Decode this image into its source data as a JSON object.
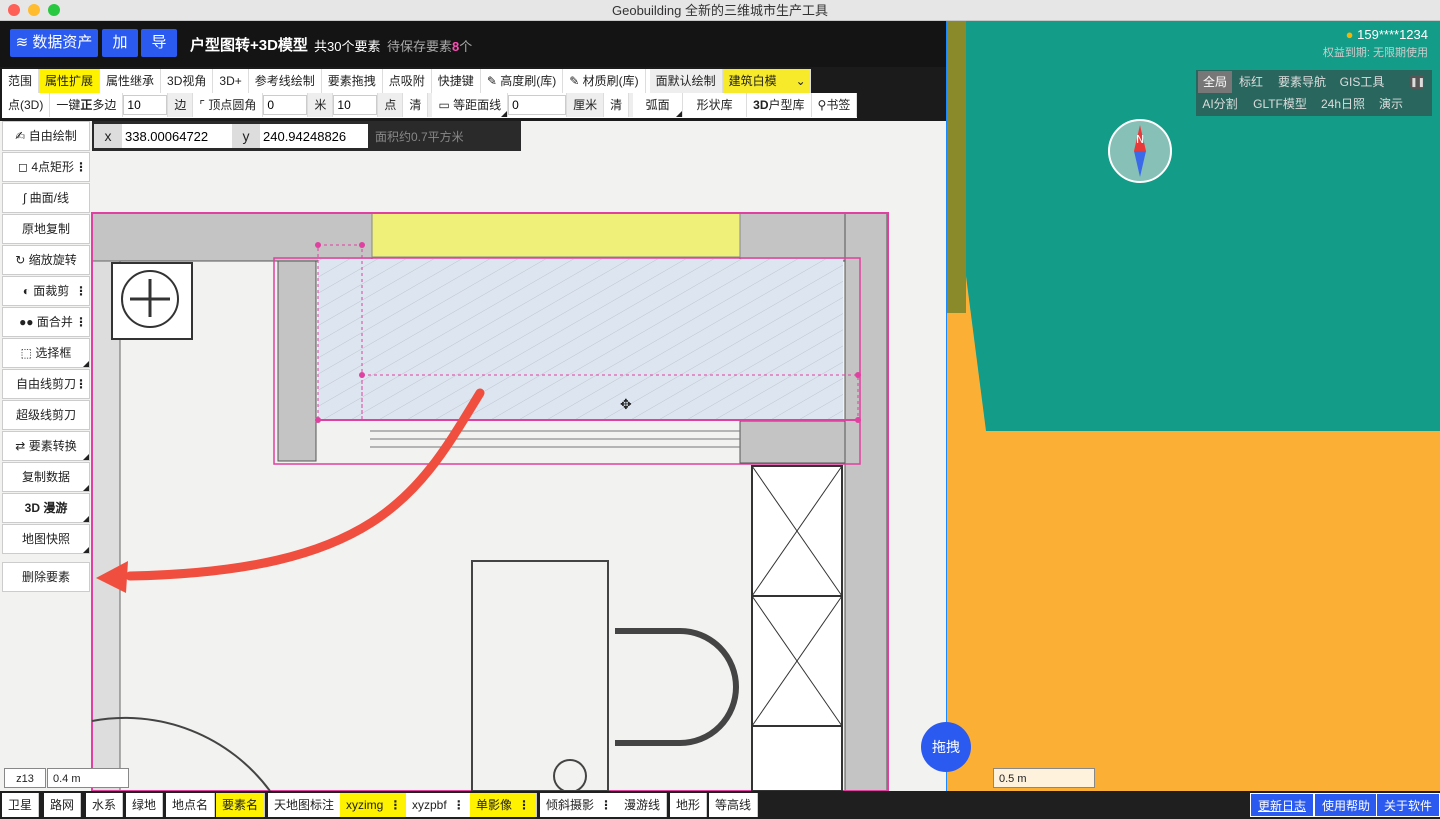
{
  "window": {
    "title": "Geobuilding 全新的三维城市生产工具"
  },
  "header": {
    "data_assets": "数据资产",
    "add": "加",
    "export": "导",
    "title": "户型图转+3D模型",
    "count": "共30个要素",
    "pending_prefix": "待保存要素",
    "pending_count": "8",
    "pending_suffix": "个",
    "user": "159****1234",
    "rights": "权益到期: 无限期使用"
  },
  "toolbar1": {
    "items": [
      "范围",
      "属性扩展",
      "属性继承",
      "3D视角",
      "3D+",
      "参考线绘制",
      "要素拖拽",
      "点吸附",
      "快捷键",
      "高度刷(库)",
      "材质刷(库)",
      "面默认绘制",
      "建筑白模"
    ]
  },
  "toolbar2": {
    "point3d": "点(3D)",
    "polygon_prefix": "一键",
    "polygon_bold": "正",
    "polygon_suffix": "多边",
    "sides_value": "10",
    "sides_unit": "边",
    "round": "顶点圆角",
    "round_value": "0",
    "round_unit": "米",
    "points_value": "10",
    "points_unit": "点",
    "clear1": "清",
    "offset": "等距面线",
    "offset_value": "0",
    "offset_unit": "厘米",
    "clear2": "清",
    "arc": "弧面",
    "shape_lib": "形状库",
    "house_lib_bold": "3D",
    "house_lib": "户型库",
    "bookmark": "书签"
  },
  "right_tabs": [
    "全局",
    "标红",
    "要素导航",
    "GIS工具",
    "AI分割",
    "GLTF模型",
    "24h日照",
    "演示"
  ],
  "left_tools": [
    "自由绘制",
    "4点矩形",
    "曲面/线",
    "原地复制",
    "缩放旋转",
    "面裁剪",
    "面合并",
    "选择框",
    "自由线剪刀",
    "超级线剪刀",
    "要素转换",
    "复制数据",
    "3D 漫游",
    "地图快照",
    "删除要素"
  ],
  "coord": {
    "x_label": "x",
    "x_value": "338.00064722",
    "y_label": "y",
    "y_value": "240.94248826",
    "area": "面积约0.7平方米"
  },
  "map": {
    "zoom": "z13",
    "scale_left": "0.4 m",
    "scale_right": "0.5 m",
    "drag": "拖拽",
    "compass": "N"
  },
  "bottom": {
    "items": [
      "卫星",
      "路网",
      "水系",
      "绿地",
      "地点名",
      "要素名",
      "天地图标注",
      "xyzimg",
      "xyzpbf",
      "单影像",
      "倾斜摄影",
      "漫游线",
      "地形",
      "等高线"
    ],
    "right": [
      "更新日志",
      "使用帮助",
      "关于软件"
    ]
  },
  "colors": {
    "accent": "#2b5af0",
    "highlight": "#fff200",
    "selection": "#e040a0",
    "arrow": "#f04e3e",
    "map3d_top": "#139c88",
    "map3d_bottom": "#fbb035"
  }
}
